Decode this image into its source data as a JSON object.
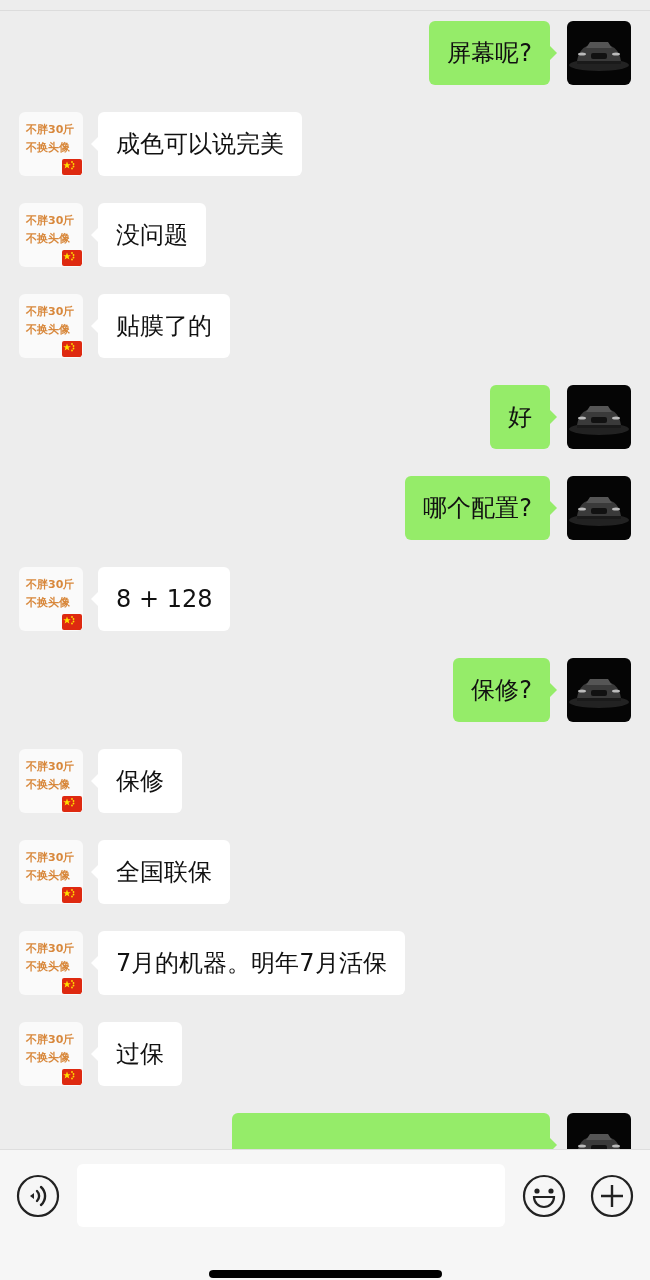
{
  "messages": [
    {
      "kind": "sent",
      "text": "屏幕呢?"
    },
    {
      "kind": "received",
      "text": "成色可以说完美",
      "avatar_lines": [
        "不胖30斤",
        "不换头像"
      ]
    },
    {
      "kind": "received",
      "text": "没问题",
      "avatar_lines": [
        "不胖30斤",
        "不换头像"
      ]
    },
    {
      "kind": "received",
      "text": "贴膜了的",
      "avatar_lines": [
        "不胖30斤",
        "不换头像"
      ]
    },
    {
      "kind": "sent",
      "text": "好"
    },
    {
      "kind": "sent",
      "text": "哪个配置?"
    },
    {
      "kind": "received",
      "text": "8 + 128",
      "avatar_lines": [
        "不胖30斤",
        "不换头像"
      ]
    },
    {
      "kind": "sent",
      "text": "保修?"
    },
    {
      "kind": "received",
      "text": "保修",
      "avatar_lines": [
        "不胖30斤",
        "不换头像"
      ]
    },
    {
      "kind": "received",
      "text": "全国联保",
      "avatar_lines": [
        "不胖30斤",
        "不换头像"
      ]
    },
    {
      "kind": "received",
      "text": "7月的机器。明年7月活保",
      "avatar_lines": [
        "不胖30斤",
        "不换头像"
      ]
    },
    {
      "kind": "received",
      "text": "过保",
      "avatar_lines": [
        "不胖30斤",
        "不换头像"
      ]
    },
    {
      "kind": "sent"
    }
  ]
}
